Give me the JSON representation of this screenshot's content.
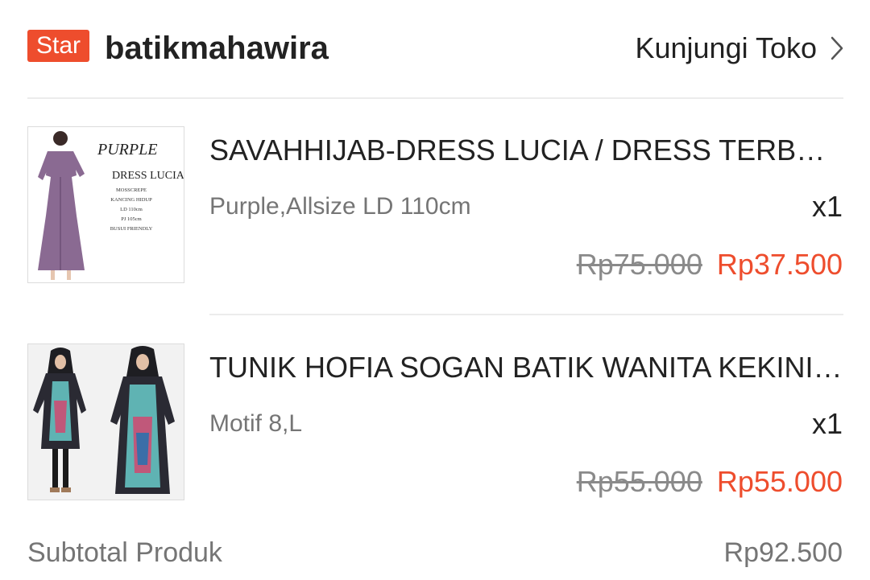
{
  "shop": {
    "badge": "Star",
    "name": "batikmahawira",
    "visit_label": "Kunjungi Toko"
  },
  "items": [
    {
      "title": "SAVAHHIJAB-DRESS LUCIA / DRESS TERBARU",
      "variant": "Purple,Allsize LD 110cm",
      "qty": "x1",
      "price_original": "Rp75.000",
      "price_discounted": "Rp37.500",
      "thumb_text": {
        "color_name": "PURPLE",
        "product_name": "DRESS LUCIA",
        "specs": [
          "MOSSCREPE",
          "KANCING HIDUP",
          "LD 110cm",
          "PJ 105cm",
          "BUSUI FRIENDLY"
        ]
      }
    },
    {
      "title": "TUNIK HOFIA SOGAN BATIK WANITA KEKINIAN",
      "variant": "Motif 8,L",
      "qty": "x1",
      "price_original": "Rp55.000",
      "price_discounted": "Rp55.000"
    }
  ],
  "subtotal": {
    "label": "Subtotal Produk",
    "value": "Rp92.500"
  },
  "colors": {
    "accent": "#ee4d2d",
    "muted_text": "#757575",
    "divider": "#ececec"
  },
  "icons": [
    "chevron-right-icon"
  ]
}
